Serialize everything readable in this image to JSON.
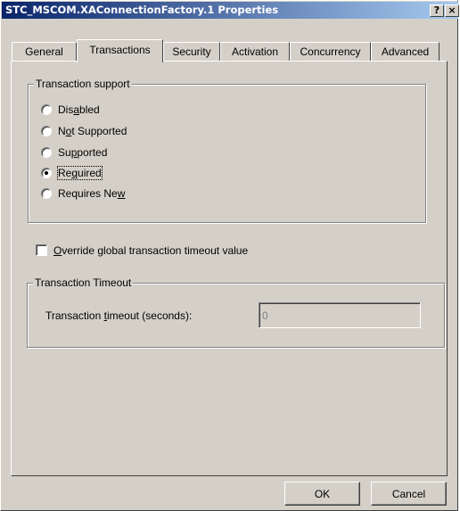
{
  "window": {
    "title": "STC_MSCOM.XAConnectionFactory.1 Properties",
    "help_label": "?",
    "close_label": "×"
  },
  "tabs": [
    {
      "label": "General",
      "active": false
    },
    {
      "label": "Transactions",
      "active": true
    },
    {
      "label": "Security",
      "active": false
    },
    {
      "label": "Activation",
      "active": false
    },
    {
      "label": "Concurrency",
      "active": false
    },
    {
      "label": "Advanced",
      "active": false
    }
  ],
  "transaction_support": {
    "legend": "Transaction support",
    "options": [
      {
        "pre": "Dis",
        "key": "a",
        "post": "bled",
        "selected": false
      },
      {
        "pre": "N",
        "key": "o",
        "post": "t Supported",
        "selected": false
      },
      {
        "pre": "Su",
        "key": "p",
        "post": "ported",
        "selected": false
      },
      {
        "pre": "Re",
        "key": "q",
        "post": "uired",
        "selected": true
      },
      {
        "pre": "Requires Ne",
        "key": "w",
        "post": "",
        "selected": false
      }
    ]
  },
  "override": {
    "key": "O",
    "rest": "verride global transaction timeout value",
    "checked": false
  },
  "timeout": {
    "legend": "Transaction Timeout",
    "label_pre": "Transaction ",
    "label_key": "t",
    "label_post": "imeout (seconds):",
    "value": "0"
  },
  "buttons": {
    "ok": "OK",
    "cancel": "Cancel"
  },
  "colors": {
    "face": "#d4d0c8",
    "title_start": "#0a246a",
    "title_end": "#a6caf0"
  }
}
